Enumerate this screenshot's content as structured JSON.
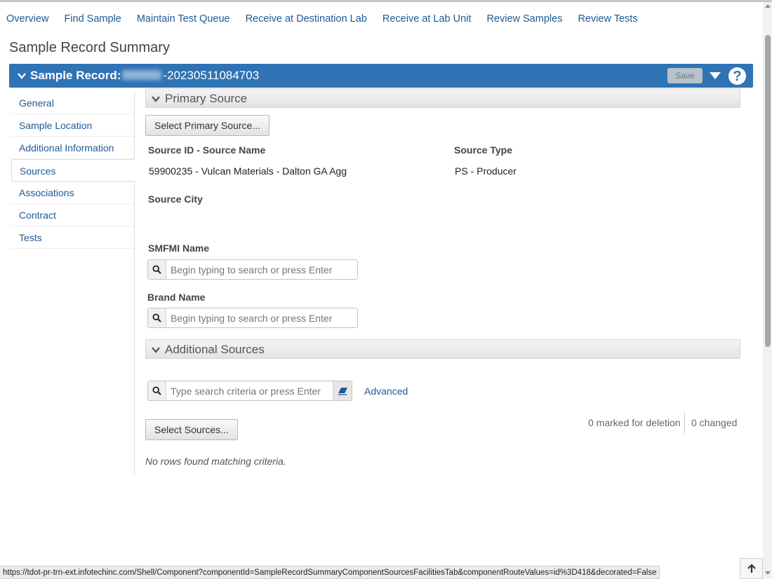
{
  "nav": {
    "items": [
      "Overview",
      "Find Sample",
      "Maintain Test Queue",
      "Receive at Destination Lab",
      "Receive at Lab Unit",
      "Review Samples",
      "Review Tests"
    ]
  },
  "page": {
    "title": "Sample Record Summary"
  },
  "record": {
    "label": "Sample Record:",
    "id_suffix": "-20230511084703",
    "save_label": "Save",
    "help": "?"
  },
  "sidebar": {
    "items": [
      {
        "label": "General"
      },
      {
        "label": "Sample Location"
      },
      {
        "label": "Additional Information"
      },
      {
        "label": "Sources",
        "active": true
      },
      {
        "label": "Associations"
      },
      {
        "label": "Contract"
      },
      {
        "label": "Tests"
      }
    ]
  },
  "primary_source": {
    "header": "Primary Source",
    "select_button": "Select Primary Source...",
    "source_id_label": "Source ID - Source Name",
    "source_id_value": "59900235 - Vulcan Materials - Dalton GA Agg",
    "source_type_label": "Source Type",
    "source_type_value": "PS - Producer",
    "source_city_label": "Source City",
    "smfmi_label": "SMFMI Name",
    "smfmi_placeholder": "Begin typing to search or press Enter",
    "brand_label": "Brand Name",
    "brand_placeholder": "Begin typing to search or press Enter"
  },
  "additional_sources": {
    "header": "Additional Sources",
    "search_placeholder": "Type search criteria or press Enter",
    "advanced_link": "Advanced",
    "select_button": "Select Sources...",
    "marked_deletion": "0 marked for deletion",
    "changed": "0 changed",
    "empty_message": "No rows found matching criteria."
  },
  "status_bar": {
    "url": "https://tdot-pr-trn-ext.infotechinc.com/Shell/Component?componentId=SampleRecordSummaryComponentSourcesFacilitiesTab&componentRouteValues=id%3D418&decorated=False"
  },
  "colors": {
    "accent": "#2f73b5",
    "link": "#1f5a93"
  }
}
